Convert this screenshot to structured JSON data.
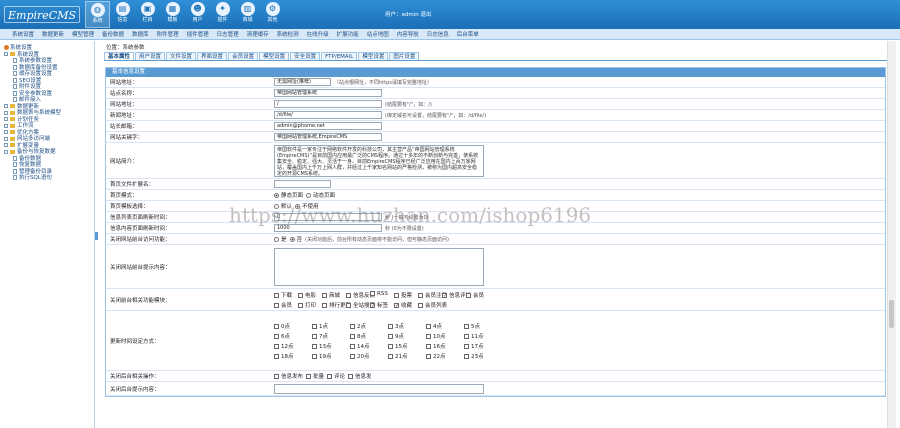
{
  "app": {
    "logo_text": "EmpireCMS",
    "user_text": "用户：admin 退出"
  },
  "nav": [
    {
      "label": "系统",
      "icon": "globe-icon"
    },
    {
      "label": "信息",
      "icon": "doc-icon"
    },
    {
      "label": "栏目",
      "icon": "folder-icon"
    },
    {
      "label": "模板",
      "icon": "template-icon"
    },
    {
      "label": "用户",
      "icon": "user-icon"
    },
    {
      "label": "插件",
      "icon": "plugin-icon"
    },
    {
      "label": "商城",
      "icon": "shop-icon"
    },
    {
      "label": "其他",
      "icon": "gear-icon"
    }
  ],
  "subnav": [
    "系统设置",
    "数据更新",
    "模型管理",
    "备份数据",
    "数据库",
    "附件管理",
    "插件管理",
    "日志管理",
    "清理缓存",
    "系统检测",
    "在线升级",
    "扩展功能",
    "站点地图",
    "内容导航",
    "日志信息",
    "后台菜单"
  ],
  "sidebar": {
    "items": [
      {
        "label": "系统设置",
        "level": 1,
        "type": "gear"
      },
      {
        "label": "系统设置",
        "level": 1,
        "type": "folder"
      },
      {
        "label": "系统参数设置",
        "level": 2,
        "type": "page"
      },
      {
        "label": "数据库备份设置",
        "level": 2,
        "type": "page"
      },
      {
        "label": "缓存设置设置",
        "level": 2,
        "type": "page"
      },
      {
        "label": "SEO设置",
        "level": 2,
        "type": "page"
      },
      {
        "label": "附件设置",
        "level": 2,
        "type": "page"
      },
      {
        "label": "安全参数设置",
        "level": 2,
        "type": "page"
      },
      {
        "label": "邮件接入",
        "level": 2,
        "type": "page"
      },
      {
        "label": "数据更新",
        "level": 1,
        "type": "folder"
      },
      {
        "label": "数据表与系统模型",
        "level": 1,
        "type": "folder"
      },
      {
        "label": "计划任务",
        "level": 1,
        "type": "folder"
      },
      {
        "label": "工作流",
        "level": 1,
        "type": "folder"
      },
      {
        "label": "优化方案",
        "level": 1,
        "type": "folder"
      },
      {
        "label": "网站多访问端",
        "level": 1,
        "type": "folder"
      },
      {
        "label": "扩展变量",
        "level": 1,
        "type": "folder"
      },
      {
        "label": "备份与恢复数据",
        "level": 1,
        "type": "folder"
      },
      {
        "label": "备份数据",
        "level": 2,
        "type": "page"
      },
      {
        "label": "恢复数据",
        "level": 2,
        "type": "page"
      },
      {
        "label": "管理备份目录",
        "level": 2,
        "type": "page"
      },
      {
        "label": "执行SQL语句",
        "level": 2,
        "type": "page"
      }
    ]
  },
  "main": {
    "breadcrumb": "位置：系统参数",
    "tabs": [
      "基本属性",
      "用户设置",
      "文件设置",
      "界面设置",
      "会员设置",
      "模型设置",
      "安全设置",
      "FTP/EMAIL",
      "模型设置",
      "图片设置"
    ],
    "panel_title": "基本信息设置",
    "fields": {
      "site_url_mode": {
        "label": "网站地址：",
        "value": "无需网址(推荐)",
        "note": "（站点根网址，不同https请填写完整地址）"
      },
      "site_name": {
        "label": "站点名称：",
        "value": "帝国网站管理系统"
      },
      "site_url": {
        "label": "网站地址：",
        "value": "/",
        "note": "(结尾要有\"/\"，如：/)"
      },
      "news_url": {
        "label": "新闻地址：",
        "value": "/d/file/",
        "note": "(绑定域名可设置，结尾要有\"/\"，如：/d/file/)"
      },
      "admin_email": {
        "label": "站长邮箱：",
        "value": "admin@phome.net"
      },
      "keywords": {
        "label": "网站关键字：",
        "value": "帝国网站管理系统,EmpireCMS"
      },
      "description": {
        "label": "网站简介：",
        "value": "帝国软件是一家专注于网络软件开发的科技公司，其主营产品“帝国网站管理系统(EmpireCMS)”是目前国内应用最广泛的CMS程序。通过十多年的不断创新与完善，使系统集安全、稳定、强大、灵活于一身。目前EmpireCMS程序已经广泛应用在国内上百万家网站，覆盖国内上千万上网人群，并经过上千家知名网站的严格检测，被称为国内超高安全稳定的开源CMS系统。"
      },
      "index_ext": {
        "label": "首页文件扩展名："
      },
      "index_mode": {
        "label": "首页模式：",
        "options": [
          "静态页面",
          "动态页面"
        ],
        "selected": 0
      },
      "index_select": {
        "label": "首页模板选择：",
        "options": [
          "默认",
          "不使用"
        ],
        "selected": 1
      },
      "list_interval": {
        "label": "信息列表页面刷新时间：",
        "value": "0",
        "note": "秒 (一般不设置为0)"
      },
      "info_interval": {
        "label": "信息内容页面刷新时间：",
        "value": "1000",
        "note": "秒 (0为不限设置)"
      },
      "open_access": {
        "label": "关闭网站前台访问功能：",
        "options": [
          "是",
          "否"
        ],
        "selected": 1,
        "note": "(关闭功能后，前台所有动态页面将不能访问，但可静态页面访问)"
      },
      "close_msg": {
        "label": "关闭网站前台提示内容："
      },
      "close_features": {
        "label": "关闭前台相关功能模块：",
        "items": [
          {
            "label": "下载",
            "checked": false
          },
          {
            "label": "电影",
            "checked": false
          },
          {
            "label": "商城",
            "checked": false
          },
          {
            "label": "信息反馈",
            "checked": false
          },
          {
            "label": "RSS",
            "checked": false
          },
          {
            "label": "投票",
            "checked": false
          },
          {
            "label": "会员注册",
            "checked": false
          },
          {
            "label": "信息评论",
            "checked": true
          },
          {
            "label": "会员",
            "checked": false
          },
          {
            "label": "会员",
            "checked": false
          },
          {
            "label": "打印",
            "checked": false
          },
          {
            "label": "排行更新",
            "checked": false
          },
          {
            "label": "全站搜索",
            "checked": false
          },
          {
            "label": "标签",
            "checked": true
          },
          {
            "label": "收藏",
            "checked": true
          },
          {
            "label": "会员列表",
            "checked": false
          }
        ]
      },
      "update_times": {
        "label": "更新时间设定方式：",
        "items": [
          {
            "label": "0点",
            "checked": false
          },
          {
            "label": "1点",
            "checked": false
          },
          {
            "label": "2点",
            "checked": false
          },
          {
            "label": "3点",
            "checked": false
          },
          {
            "label": "4点",
            "checked": false
          },
          {
            "label": "5点",
            "checked": false
          },
          {
            "label": "6点",
            "checked": false
          },
          {
            "label": "7点",
            "checked": false
          },
          {
            "label": "8点",
            "checked": false
          },
          {
            "label": "9点",
            "checked": false
          },
          {
            "label": "10点",
            "checked": false
          },
          {
            "label": "11点",
            "checked": false
          },
          {
            "label": "12点",
            "checked": false
          },
          {
            "label": "13点",
            "checked": false
          },
          {
            "label": "14点",
            "checked": false
          },
          {
            "label": "15点",
            "checked": false
          },
          {
            "label": "16点",
            "checked": false
          },
          {
            "label": "17点",
            "checked": false
          },
          {
            "label": "18点",
            "checked": false
          },
          {
            "label": "19点",
            "checked": false
          },
          {
            "label": "20点",
            "checked": false
          },
          {
            "label": "21点",
            "checked": false
          },
          {
            "label": "22点",
            "checked": false
          },
          {
            "label": "23点",
            "checked": false
          }
        ]
      },
      "close_ops": {
        "label": "关闭后台相关操作：",
        "items": [
          {
            "label": "信息发布",
            "checked": false
          },
          {
            "label": "批量",
            "checked": false
          },
          {
            "label": "评论",
            "checked": false
          },
          {
            "label": "信息发",
            "checked": false
          }
        ]
      },
      "close_ops_tip": {
        "label": "关闭后台提示内容："
      }
    }
  },
  "watermark": "https://www.huzhan.com/ishop6196"
}
